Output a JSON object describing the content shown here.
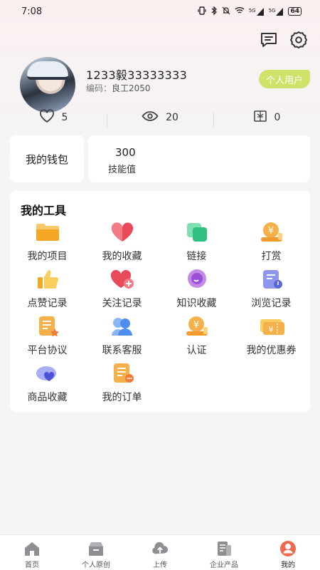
{
  "status_bar": {
    "time": "7:08",
    "signal_1": "5G",
    "signal_2": "5G",
    "battery": "64"
  },
  "profile": {
    "username": "1233毅33333333",
    "code_label": "编码：",
    "code_value": "良工2050",
    "user_type": "个人用户"
  },
  "stats": [
    {
      "icon": "heart-icon",
      "value": "5"
    },
    {
      "icon": "eye-icon",
      "value": "20"
    },
    {
      "icon": "coin-book-icon",
      "value": "0"
    }
  ],
  "wallet": {
    "title": "我的钱包",
    "value": "300",
    "label": "技能值"
  },
  "tools": {
    "title": "我的工具",
    "items": [
      {
        "label": "我的项目",
        "icon": "folder-icon",
        "color": "#f5b342"
      },
      {
        "label": "我的收藏",
        "icon": "heart-icon",
        "color": "#e84a5a"
      },
      {
        "label": "链接",
        "icon": "link-squares-icon",
        "color": "#3cc98a"
      },
      {
        "label": "打赏",
        "icon": "reward-coin-icon",
        "color": "#f5a53a"
      },
      {
        "label": "点赞记录",
        "icon": "thumbs-up-icon",
        "color": "#f6c04a"
      },
      {
        "label": "关注记录",
        "icon": "heart-plus-icon",
        "color": "#e84a5a"
      },
      {
        "label": "知识收藏",
        "icon": "chat-bubble-icon",
        "color": "#b36be0"
      },
      {
        "label": "浏览记录",
        "icon": "document-music-icon",
        "color": "#7a86e8"
      },
      {
        "label": "平台协议",
        "icon": "agreement-doc-icon",
        "color": "#f5a53a"
      },
      {
        "label": "联系客服",
        "icon": "customer-service-icon",
        "color": "#4f8ef0"
      },
      {
        "label": "认证",
        "icon": "certification-coin-icon",
        "color": "#f5a53a"
      },
      {
        "label": "我的优惠券",
        "icon": "coupon-icon",
        "color": "#f6c04a"
      },
      {
        "label": "商品收藏",
        "icon": "product-favorite-icon",
        "color": "#6b6fe8"
      },
      {
        "label": "我的订单",
        "icon": "order-doc-icon",
        "color": "#f5a53a"
      }
    ]
  },
  "tabbar": [
    {
      "label": "首页",
      "icon": "home-icon",
      "active": false
    },
    {
      "label": "个人原创",
      "icon": "original-box-icon",
      "active": false
    },
    {
      "label": "上传",
      "icon": "cloud-upload-icon",
      "active": false
    },
    {
      "label": "企业产品",
      "icon": "product-doc-icon",
      "active": false
    },
    {
      "label": "我的",
      "icon": "person-icon",
      "active": true
    }
  ],
  "colors": {
    "accent": "#f06a4f",
    "badge": "#cfe26a",
    "inactive_icon": "#8e8e93"
  }
}
